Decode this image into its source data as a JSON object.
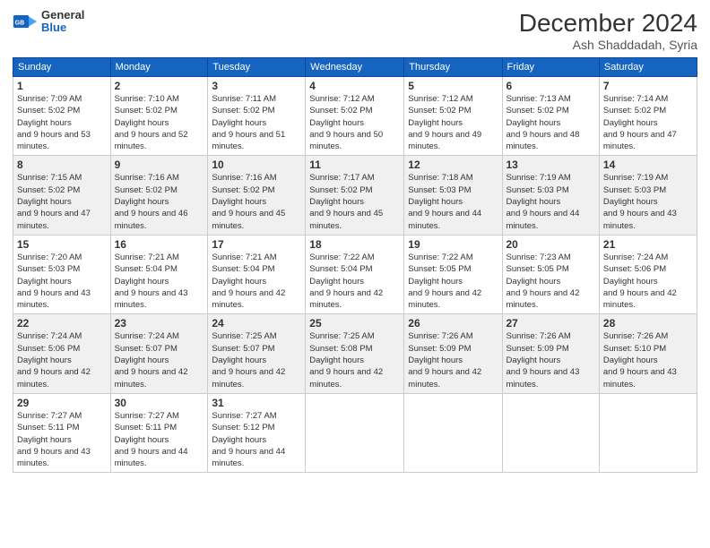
{
  "header": {
    "logo_line1": "General",
    "logo_line2": "Blue",
    "month_year": "December 2024",
    "location": "Ash Shaddadah, Syria"
  },
  "days_of_week": [
    "Sunday",
    "Monday",
    "Tuesday",
    "Wednesday",
    "Thursday",
    "Friday",
    "Saturday"
  ],
  "weeks": [
    [
      {
        "num": "1",
        "rise": "7:09 AM",
        "set": "5:02 PM",
        "daylight": "9 hours and 53 minutes."
      },
      {
        "num": "2",
        "rise": "7:10 AM",
        "set": "5:02 PM",
        "daylight": "9 hours and 52 minutes."
      },
      {
        "num": "3",
        "rise": "7:11 AM",
        "set": "5:02 PM",
        "daylight": "9 hours and 51 minutes."
      },
      {
        "num": "4",
        "rise": "7:12 AM",
        "set": "5:02 PM",
        "daylight": "9 hours and 50 minutes."
      },
      {
        "num": "5",
        "rise": "7:12 AM",
        "set": "5:02 PM",
        "daylight": "9 hours and 49 minutes."
      },
      {
        "num": "6",
        "rise": "7:13 AM",
        "set": "5:02 PM",
        "daylight": "9 hours and 48 minutes."
      },
      {
        "num": "7",
        "rise": "7:14 AM",
        "set": "5:02 PM",
        "daylight": "9 hours and 47 minutes."
      }
    ],
    [
      {
        "num": "8",
        "rise": "7:15 AM",
        "set": "5:02 PM",
        "daylight": "9 hours and 47 minutes."
      },
      {
        "num": "9",
        "rise": "7:16 AM",
        "set": "5:02 PM",
        "daylight": "9 hours and 46 minutes."
      },
      {
        "num": "10",
        "rise": "7:16 AM",
        "set": "5:02 PM",
        "daylight": "9 hours and 45 minutes."
      },
      {
        "num": "11",
        "rise": "7:17 AM",
        "set": "5:02 PM",
        "daylight": "9 hours and 45 minutes."
      },
      {
        "num": "12",
        "rise": "7:18 AM",
        "set": "5:03 PM",
        "daylight": "9 hours and 44 minutes."
      },
      {
        "num": "13",
        "rise": "7:19 AM",
        "set": "5:03 PM",
        "daylight": "9 hours and 44 minutes."
      },
      {
        "num": "14",
        "rise": "7:19 AM",
        "set": "5:03 PM",
        "daylight": "9 hours and 43 minutes."
      }
    ],
    [
      {
        "num": "15",
        "rise": "7:20 AM",
        "set": "5:03 PM",
        "daylight": "9 hours and 43 minutes."
      },
      {
        "num": "16",
        "rise": "7:21 AM",
        "set": "5:04 PM",
        "daylight": "9 hours and 43 minutes."
      },
      {
        "num": "17",
        "rise": "7:21 AM",
        "set": "5:04 PM",
        "daylight": "9 hours and 42 minutes."
      },
      {
        "num": "18",
        "rise": "7:22 AM",
        "set": "5:04 PM",
        "daylight": "9 hours and 42 minutes."
      },
      {
        "num": "19",
        "rise": "7:22 AM",
        "set": "5:05 PM",
        "daylight": "9 hours and 42 minutes."
      },
      {
        "num": "20",
        "rise": "7:23 AM",
        "set": "5:05 PM",
        "daylight": "9 hours and 42 minutes."
      },
      {
        "num": "21",
        "rise": "7:24 AM",
        "set": "5:06 PM",
        "daylight": "9 hours and 42 minutes."
      }
    ],
    [
      {
        "num": "22",
        "rise": "7:24 AM",
        "set": "5:06 PM",
        "daylight": "9 hours and 42 minutes."
      },
      {
        "num": "23",
        "rise": "7:24 AM",
        "set": "5:07 PM",
        "daylight": "9 hours and 42 minutes."
      },
      {
        "num": "24",
        "rise": "7:25 AM",
        "set": "5:07 PM",
        "daylight": "9 hours and 42 minutes."
      },
      {
        "num": "25",
        "rise": "7:25 AM",
        "set": "5:08 PM",
        "daylight": "9 hours and 42 minutes."
      },
      {
        "num": "26",
        "rise": "7:26 AM",
        "set": "5:09 PM",
        "daylight": "9 hours and 42 minutes."
      },
      {
        "num": "27",
        "rise": "7:26 AM",
        "set": "5:09 PM",
        "daylight": "9 hours and 43 minutes."
      },
      {
        "num": "28",
        "rise": "7:26 AM",
        "set": "5:10 PM",
        "daylight": "9 hours and 43 minutes."
      }
    ],
    [
      {
        "num": "29",
        "rise": "7:27 AM",
        "set": "5:11 PM",
        "daylight": "9 hours and 43 minutes."
      },
      {
        "num": "30",
        "rise": "7:27 AM",
        "set": "5:11 PM",
        "daylight": "9 hours and 44 minutes."
      },
      {
        "num": "31",
        "rise": "7:27 AM",
        "set": "5:12 PM",
        "daylight": "9 hours and 44 minutes."
      },
      null,
      null,
      null,
      null
    ]
  ]
}
